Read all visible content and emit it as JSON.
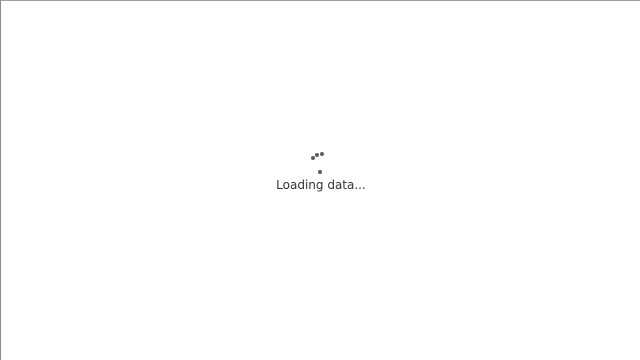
{
  "loader": {
    "icon": "spinner-icon",
    "text": "Loading data..."
  },
  "colors": {
    "background": "#ffffff",
    "dots": "#5f5f5f",
    "text": "#333333"
  }
}
